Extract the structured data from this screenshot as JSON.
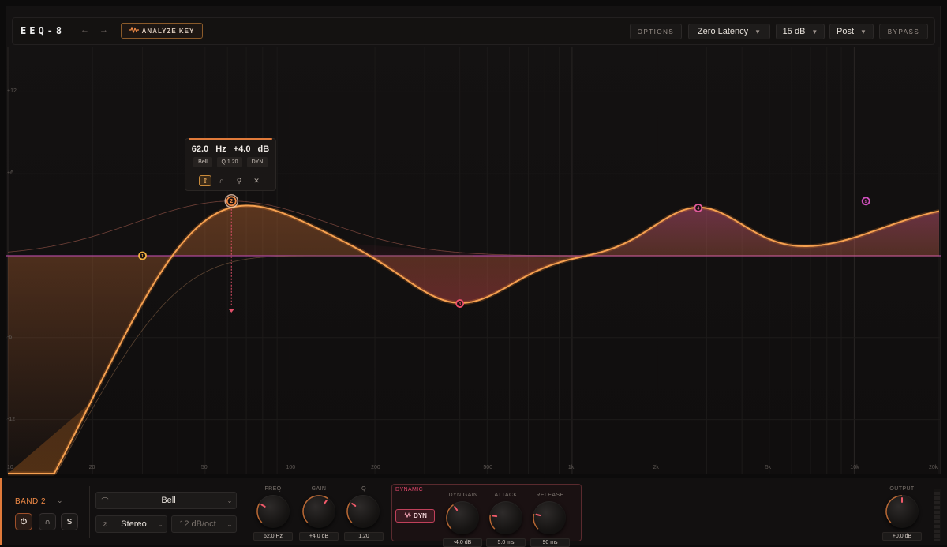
{
  "header": {
    "title": "EEQ-8",
    "back_icon": "←",
    "forward_icon": "→",
    "analyze_label": "ANALYZE KEY",
    "options_label": "OPTIONS",
    "latency": "Zero Latency",
    "range": "15 dB",
    "position": "Post",
    "bypass_label": "BYPASS"
  },
  "graph": {
    "db_labels": [
      "+12",
      "+6",
      "-6",
      "-12"
    ],
    "freq_labels": [
      "10",
      "20",
      "50",
      "100",
      "200",
      "500",
      "1k",
      "2k",
      "5k",
      "10k",
      "20k"
    ],
    "bands": [
      {
        "id": "1",
        "freq_hz": 30,
        "gain_db": 0,
        "color": "#f2b040"
      },
      {
        "id": "2",
        "freq_hz": 62,
        "gain_db": 4.0,
        "color": "#f08a46",
        "selected": true
      },
      {
        "id": "3",
        "freq_hz": 400,
        "gain_db": -3.5,
        "color": "#f0506a"
      },
      {
        "id": "4",
        "freq_hz": 2800,
        "gain_db": 3.5,
        "color": "#e05a9a"
      },
      {
        "id": "5",
        "freq_hz": 11000,
        "gain_db": 4.0,
        "color": "#d050c0"
      }
    ]
  },
  "tooltip": {
    "freq": "62.0 Hz",
    "gain": "+4.0 dB",
    "type_chip": "Bell",
    "q_chip": "Q 1.20",
    "dyn_chip": "DYN"
  },
  "band_panel": {
    "name": "BAND 2",
    "chevron": "⌄",
    "solo_label": "S",
    "filter_type": "Bell",
    "channel": "Stereo",
    "slope": "12 dB/oct"
  },
  "knobs": {
    "freq": {
      "label": "FREQ",
      "value": "62.0 Hz",
      "level": 0.28
    },
    "gain": {
      "label": "GAIN",
      "value": "+4.0 dB",
      "level": 0.63
    },
    "q": {
      "label": "Q",
      "value": "1.20",
      "level": 0.3
    }
  },
  "dynamic": {
    "section_label": "DYNAMIC",
    "dyn_button": "DYN",
    "dyn_gain": {
      "label": "DYN GAIN",
      "value": "-4.0 dB",
      "level": 0.37
    },
    "attack": {
      "label": "ATTACK",
      "value": "5.0 ms",
      "level": 0.2
    },
    "release": {
      "label": "RELEASE",
      "value": "90 ms",
      "level": 0.22
    }
  },
  "output": {
    "label": "OUTPUT",
    "value": "+0.0 dB",
    "level": 0.5
  },
  "colors": {
    "accent": "#f08a46",
    "dynamic": "#e0466a",
    "curve": "#f5a050"
  }
}
